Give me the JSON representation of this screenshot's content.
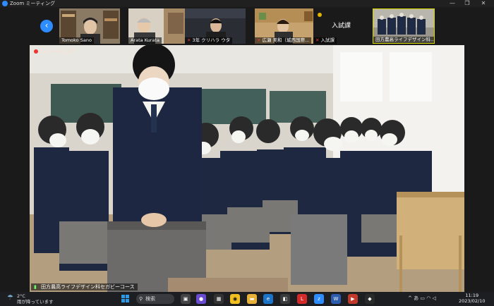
{
  "window": {
    "title": "Zoom ミーティング",
    "controls": [
      "—",
      "❐",
      "✕"
    ]
  },
  "gallery": {
    "prev_icon": "‹",
    "participants": [
      {
        "name": "Tomoko Sano",
        "muted": false
      },
      {
        "name": "Arata Kurata",
        "muted": false
      },
      {
        "name": "3年 クリハラ ウタ",
        "muted": true
      },
      {
        "name": "広瀬 美和（城西国際...",
        "muted": true
      },
      {
        "name": "入試課",
        "muted": true
      },
      {
        "name": "田方農高ライフデザイン科...",
        "muted": false
      }
    ],
    "text_tile_label": "入試課"
  },
  "main_video": {
    "recording_label": "レコーディング",
    "speaker_label": "田方農高ライフデザイン科セガビーコース"
  },
  "taskbar": {
    "weather_temp": "2°C",
    "weather_desc": "雨が降っています",
    "search_label": "検索",
    "ime": "あ",
    "time": "11:19",
    "date": "2023/02/10"
  }
}
